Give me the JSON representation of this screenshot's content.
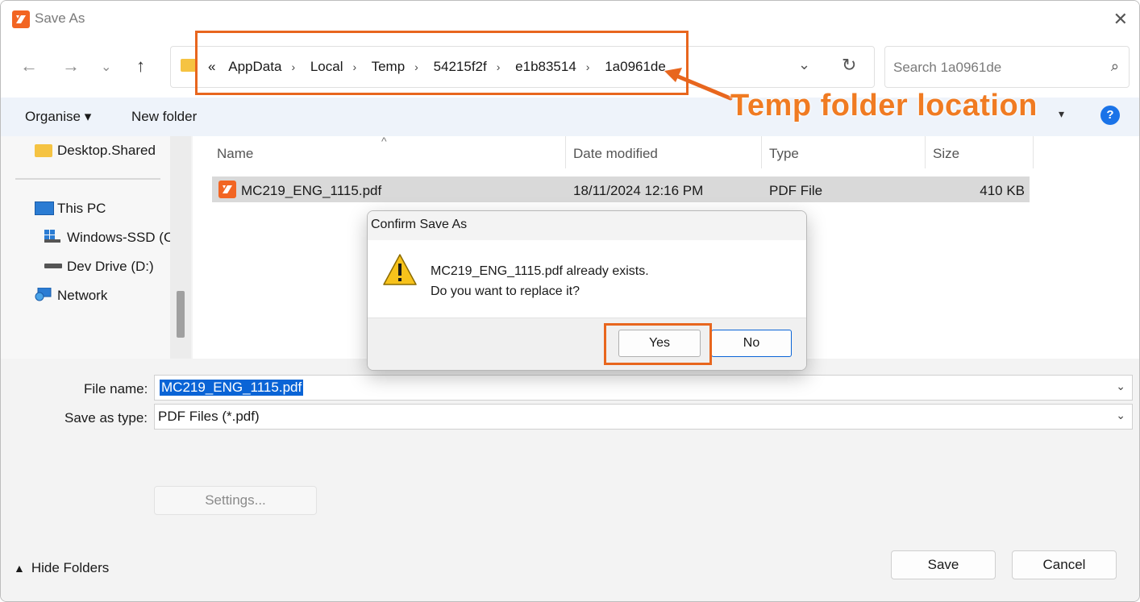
{
  "window": {
    "title": "Save As"
  },
  "address": {
    "crumbs": [
      "AppData",
      "Local",
      "Temp",
      "54215f2f",
      "e1b83514",
      "1a0961de"
    ],
    "overflow": "«"
  },
  "search": {
    "placeholder": "Search 1a0961de"
  },
  "annotation": {
    "text": "Temp folder location",
    "color": "#f07b22"
  },
  "toolbar": {
    "organise": "Organise ▾",
    "new_folder": "New folder",
    "help": "?"
  },
  "sidebar": {
    "items": [
      {
        "label": "Desktop.Shared"
      },
      {
        "label": "This PC"
      },
      {
        "label": "Windows-SSD (C"
      },
      {
        "label": "Dev Drive (D:)"
      },
      {
        "label": "Network"
      }
    ]
  },
  "filelist": {
    "columns": [
      "Name",
      "Date modified",
      "Type",
      "Size"
    ],
    "rows": [
      {
        "name": "MC219_ENG_1115.pdf",
        "date": "18/11/2024 12:16 PM",
        "type": "PDF File",
        "size": "410 KB"
      }
    ]
  },
  "form": {
    "file_name_label": "File name:",
    "file_name_value": "MC219_ENG_1115.pdf",
    "save_type_label": "Save as type:",
    "save_type_value": "PDF Files (*.pdf)",
    "settings_button": "Settings...",
    "hide_folders": "Hide Folders",
    "save_button": "Save",
    "cancel_button": "Cancel"
  },
  "dialog": {
    "title": "Confirm Save As",
    "line1": "MC219_ENG_1115.pdf already exists.",
    "line2": "Do you want to replace it?",
    "yes": "Yes",
    "no": "No"
  },
  "colors": {
    "accent": "#0a64d6",
    "highlight": "#e8661e",
    "app_icon": "#f26522"
  }
}
